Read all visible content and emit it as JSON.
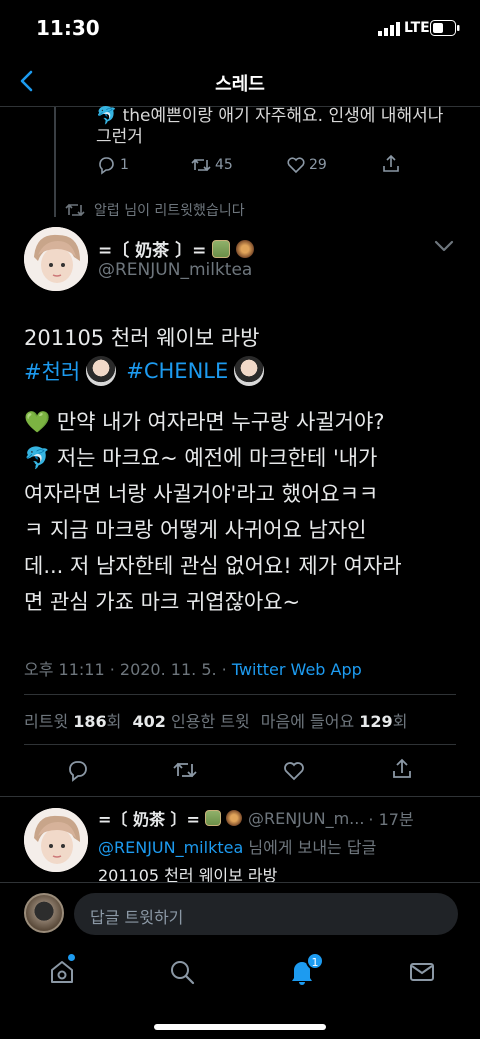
{
  "status": {
    "time": "11:30",
    "network": "LTE"
  },
  "header": {
    "title": "스레드"
  },
  "prev_tweet": {
    "text": "🐬 the예쁜이랑 애기 자주해요. 인생에 내해서나",
    "text2": "그런거",
    "replies": "1",
    "retweets": "45",
    "likes": "29"
  },
  "retweet_note": "알럽 님이 리트윗했습니다",
  "tweet": {
    "display_name": "=〔 奶茶 〕=",
    "handle": "@RENJUN_milktea",
    "line1": "201105 천러 웨이보 라방",
    "hashtag1": "#천러",
    "hashtag2": "#CHENLE",
    "body1": "💚 만약 내가 여자라면 누구랑 사귈거야?",
    "body2": "🐬 저는 마크요~ 예전에 마크한테 '내가",
    "body3": "여자라면 너랑 사귈거야'라고 했어요ㅋㅋ",
    "body4": "ㅋ 지금 마크랑 어떻게 사귀어요 남자인",
    "body5": "데... 저 남자한테 관심 없어요! 제가 여자라",
    "body6": "면 관심 가죠 마크 귀엽잖아요~",
    "timestamp": "오후 11:11 · 2020. 11. 5. · ",
    "source": "Twitter Web App"
  },
  "stats": {
    "retweet_label": "리트윗",
    "retweet_count": "186",
    "retweet_unit": "회",
    "quote_count": "402",
    "quote_label": "인용한 트윗",
    "like_label": "마음에 들어요",
    "like_count": "129",
    "like_unit": "회"
  },
  "reply": {
    "display_name": "=〔 奶茶 〕=",
    "handle": "@RENJUN_m...",
    "time": "· 17분",
    "mention": "@RENJUN_milktea",
    "mention_suffix": " 님에게 보내는 답글",
    "text": "201105 천러 웨이보 라방"
  },
  "compose": {
    "placeholder": "답글 트윗하기"
  },
  "tabbar": {
    "notif_badge": "1"
  },
  "colors": {
    "accent": "#1d9bf0",
    "background": "#000000",
    "divider": "#2f3336",
    "muted": "#6e767d"
  }
}
